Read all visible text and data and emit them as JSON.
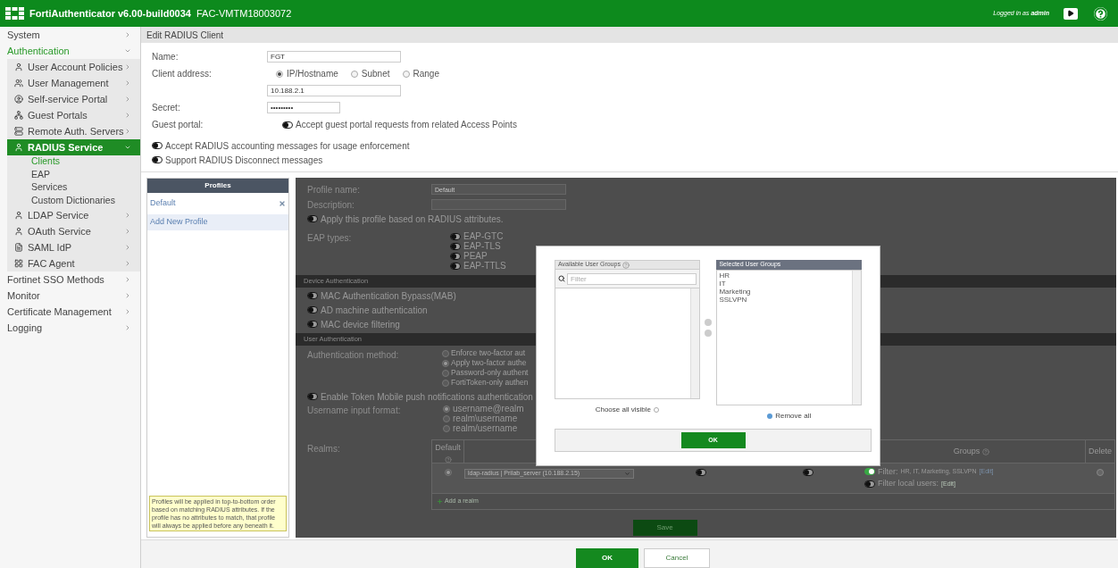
{
  "header": {
    "product": "FortiAuthenticator v6.00-build0034",
    "serial": "FAC-VMTM18003072",
    "logged_in": "Logged in as **admin**"
  },
  "sidebar": {
    "items": [
      {
        "label": "System",
        "expanded": false,
        "selected": false
      },
      {
        "label": "Authentication",
        "expanded": true,
        "selected": true,
        "children": [
          {
            "label": "User Account Policies",
            "expanded": false,
            "selected": false
          },
          {
            "label": "User Management",
            "expanded": false,
            "selected": false
          },
          {
            "label": "Self-service Portal",
            "expanded": false,
            "selected": false
          },
          {
            "label": "Guest Portals",
            "expanded": false,
            "selected": false
          },
          {
            "label": "Remote Auth. Servers",
            "expanded": false,
            "selected": false
          },
          {
            "label": "RADIUS Service",
            "expanded": true,
            "selected": true,
            "children": [
              {
                "label": "Clients",
                "selected": true
              },
              {
                "label": "EAP",
                "selected": false
              },
              {
                "label": "Services",
                "selected": false
              },
              {
                "label": "Custom Dictionaries",
                "selected": false
              }
            ]
          },
          {
            "label": "LDAP Service",
            "expanded": false,
            "selected": false
          },
          {
            "label": "OAuth Service",
            "expanded": false,
            "selected": false
          },
          {
            "label": "SAML IdP",
            "expanded": false,
            "selected": false
          },
          {
            "label": "FAC Agent",
            "expanded": false,
            "selected": false
          }
        ]
      },
      {
        "label": "Fortinet SSO Methods",
        "expanded": false,
        "selected": false
      },
      {
        "label": "Monitor",
        "expanded": false,
        "selected": false
      },
      {
        "label": "Certificate Management",
        "expanded": false,
        "selected": false
      },
      {
        "label": "Logging",
        "expanded": false,
        "selected": false
      }
    ]
  },
  "page_title": "Edit RADIUS Client",
  "form": {
    "name": {
      "label": "Name:",
      "value": "FGT"
    },
    "client_address": {
      "label": "Client address:",
      "options": [
        {
          "label": "IP/Hostname",
          "selected": true
        },
        {
          "label": "Subnet",
          "selected": false
        },
        {
          "label": "Range",
          "selected": false
        }
      ],
      "value": "10.188.2.1"
    },
    "secret": {
      "label": "Secret:",
      "value": "•••••••••"
    },
    "guest_portal": {
      "label": "Guest portal:",
      "toggle": {
        "label": "Accept guest portal requests from related Access Points",
        "on": false
      }
    },
    "toggles": [
      {
        "label": "Accept RADIUS accounting messages for usage enforcement",
        "on": false
      },
      {
        "label": "Support RADIUS Disconnect messages",
        "on": false
      }
    ]
  },
  "profiles": {
    "title": "Profiles",
    "items": [
      {
        "label": "Default"
      }
    ],
    "add_label": "Add New Profile",
    "note": "Profiles will be applied in top-to-bottom order based on matching RADIUS attributes. If the profile has no attributes to match, that profile will always be applied before any beneath it."
  },
  "editor": {
    "profile_name": {
      "label": "Profile name:",
      "value": "Default"
    },
    "description": {
      "label": "Description:"
    },
    "apply_toggle": {
      "label": "Apply this profile based on RADIUS attributes.",
      "on": false
    },
    "eap_types": {
      "label": "EAP types:",
      "options": [
        {
          "label": "EAP-GTC",
          "on": false
        },
        {
          "label": "EAP-TLS",
          "on": false
        },
        {
          "label": "PEAP",
          "on": false
        },
        {
          "label": "EAP-TTLS",
          "on": false
        }
      ]
    },
    "device_auth": {
      "title": "Device Authentication",
      "toggles": [
        {
          "label": "MAC Authentication Bypass(MAB)",
          "on": false
        },
        {
          "label": "AD machine authentication",
          "on": false
        },
        {
          "label": "MAC device filtering",
          "on": false
        }
      ]
    },
    "user_auth": {
      "title": "User Authentication",
      "method": {
        "label": "Authentication method:",
        "options": [
          {
            "label": "Enforce two-factor aut",
            "selected": false
          },
          {
            "label": "Apply two-factor authe",
            "selected": true
          },
          {
            "label": "Password-only authent",
            "selected": false
          },
          {
            "label": "FortiToken-only authen",
            "selected": false
          }
        ]
      },
      "token_toggle": {
        "label": "Enable Token Mobile push notifications authentication",
        "on": false
      },
      "username_format": {
        "label": "Username input format:",
        "options": [
          {
            "label": "username@realm",
            "selected": true
          },
          {
            "label": "realm\\username",
            "selected": false
          },
          {
            "label": "realm/username",
            "selected": false
          }
        ]
      }
    },
    "realms": {
      "label": "Realms:",
      "columns": [
        "Default",
        "Groups",
        "Delete"
      ],
      "rows": [
        {
          "selected": true,
          "server": "ldap-radius | Prilab_server (10.188.2.15)",
          "toggle_1": false,
          "toggle_2": false,
          "groups_filter": {
            "on": true,
            "label": "Filter:",
            "value": "HR, IT, Marketing, SSLVPN",
            "edit": "[Edit]"
          },
          "local_filter": {
            "on": false,
            "label": "Filter local users:",
            "edit": "[Edit]"
          }
        }
      ],
      "add_label": "Add a realm"
    },
    "save": "Save"
  },
  "modal": {
    "available": {
      "title": "Available User Groups",
      "filter_placeholder": "Filter",
      "choose_all": "Choose all visible"
    },
    "selected": {
      "title": "Selected User Groups",
      "items": [
        "HR",
        "IT",
        "Marketing",
        "SSLVPN"
      ],
      "remove_all": "Remove all"
    },
    "ok": "OK"
  },
  "footer": {
    "ok": "OK",
    "cancel": "Cancel"
  }
}
